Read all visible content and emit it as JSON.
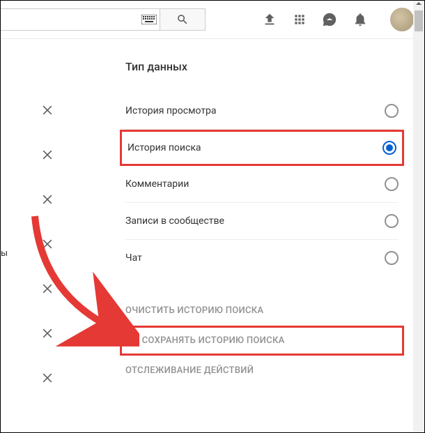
{
  "search": {
    "placeholder": ""
  },
  "section_title": "Тип данных",
  "options": [
    {
      "label": "История просмотра",
      "selected": false
    },
    {
      "label": "История поиска",
      "selected": true
    },
    {
      "label": "Комментарии",
      "selected": false
    },
    {
      "label": "Записи в сообществе",
      "selected": false
    },
    {
      "label": "Чат",
      "selected": false
    }
  ],
  "actions": [
    {
      "label": "ОЧИСТИТЬ ИСТОРИЮ ПОИСКА"
    },
    {
      "label": "НЕ СОХРАНЯТЬ ИСТОРИЮ ПОИСКА"
    },
    {
      "label": "ОТСЛЕЖИВАНИЕ ДЕЙСТВИЙ"
    }
  ],
  "side_char": "ы"
}
